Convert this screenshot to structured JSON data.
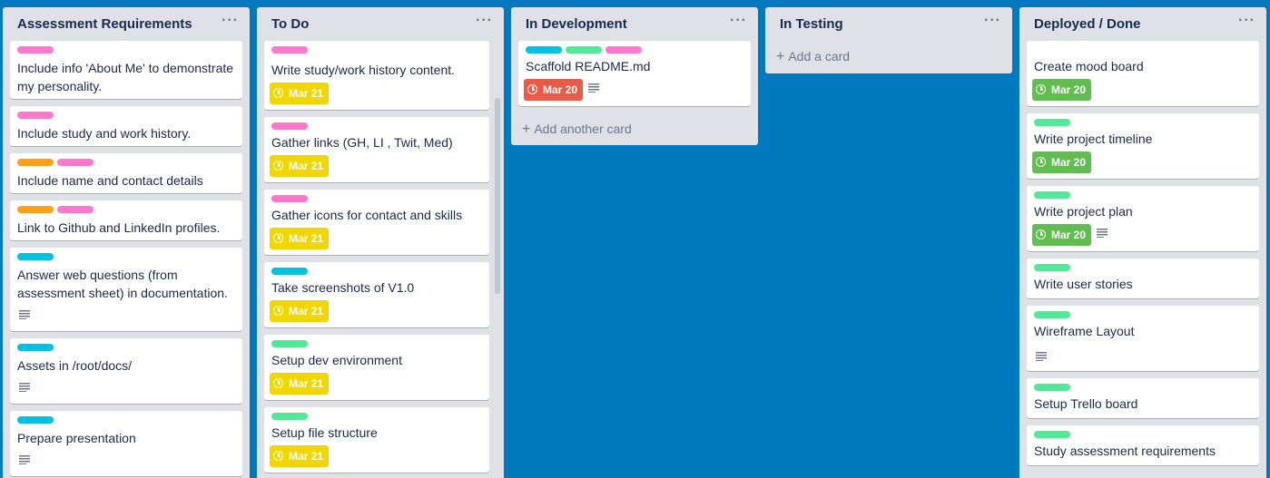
{
  "colors": {
    "board_bg": "#0079bf",
    "list_bg": "#dfe1e6",
    "label_pink": "#ff78cb",
    "label_orange": "#ff9f1a",
    "label_cyan": "#00c2e0",
    "label_green": "#51e898",
    "due_yellow": "#f2d600",
    "due_green": "#61bd4f",
    "due_red": "#eb5a46"
  },
  "lists": [
    {
      "title": "Assessment Requirements",
      "menu": "···",
      "cards": [
        {
          "labels": [
            "pink"
          ],
          "title": "Include info 'About Me' to demonstrate my personality."
        },
        {
          "labels": [
            "pink"
          ],
          "title": "Include study and work history."
        },
        {
          "labels": [
            "orange",
            "pink"
          ],
          "title": "Include name and contact details"
        },
        {
          "labels": [
            "orange",
            "pink"
          ],
          "title": "Link to Github and LinkedIn profiles."
        },
        {
          "labels": [
            "cyan"
          ],
          "title": "Answer web questions (from assessment sheet) in documentation.",
          "description_icon": "description-icon"
        },
        {
          "labels": [
            "cyan"
          ],
          "title": "Assets in /root/docs/",
          "description_icon": "description-icon"
        },
        {
          "labels": [
            "cyan"
          ],
          "title": "Prepare presentation",
          "description_icon": "description-icon"
        }
      ]
    },
    {
      "title": "To Do",
      "menu": "···",
      "cards": [
        {
          "labels": [
            "pink"
          ],
          "title": "Write study/work history content.",
          "due": "Mar 21",
          "due_color": "yellow"
        },
        {
          "labels": [
            "pink"
          ],
          "title": "Gather links (GH, LI , Twit, Med)",
          "due": "Mar 21",
          "due_color": "yellow"
        },
        {
          "labels": [
            "pink"
          ],
          "title": "Gather icons for contact and skills",
          "due": "Mar 21",
          "due_color": "yellow"
        },
        {
          "labels": [
            "cyan"
          ],
          "title": "Take screenshots of V1.0",
          "due": "Mar 21",
          "due_color": "yellow"
        },
        {
          "labels": [
            "green"
          ],
          "title": "Setup dev environment",
          "due": "Mar 21",
          "due_color": "yellow"
        },
        {
          "labels": [
            "green"
          ],
          "title": "Setup file structure",
          "due": "Mar 21",
          "due_color": "yellow"
        }
      ]
    },
    {
      "title": "In Development",
      "menu": "···",
      "cards": [
        {
          "labels": [
            "cyan",
            "green",
            "pink"
          ],
          "title": "Scaffold README.md",
          "due": "Mar 20",
          "due_color": "red",
          "description_icon": "description-icon"
        }
      ],
      "add_label": "Add another card"
    },
    {
      "title": "In Testing",
      "menu": "···",
      "cards": [],
      "add_label": "Add a card"
    },
    {
      "title": "Deployed / Done",
      "menu": "···",
      "cards": [
        {
          "labels": [],
          "title": "Create mood board",
          "due": "Mar 20",
          "due_color": "green"
        },
        {
          "labels": [
            "green"
          ],
          "title": "Write project timeline",
          "due": "Mar 20",
          "due_color": "green"
        },
        {
          "labels": [
            "green"
          ],
          "title": "Write project plan",
          "due": "Mar 20",
          "due_color": "green",
          "description_icon": "description-icon"
        },
        {
          "labels": [
            "green"
          ],
          "title": "Write user stories"
        },
        {
          "labels": [
            "green"
          ],
          "title": "Wireframe Layout",
          "description_icon": "description-icon"
        },
        {
          "labels": [
            "green"
          ],
          "title": "Setup Trello board"
        },
        {
          "labels": [
            "green"
          ],
          "title": "Study assessment requirements"
        }
      ]
    }
  ]
}
